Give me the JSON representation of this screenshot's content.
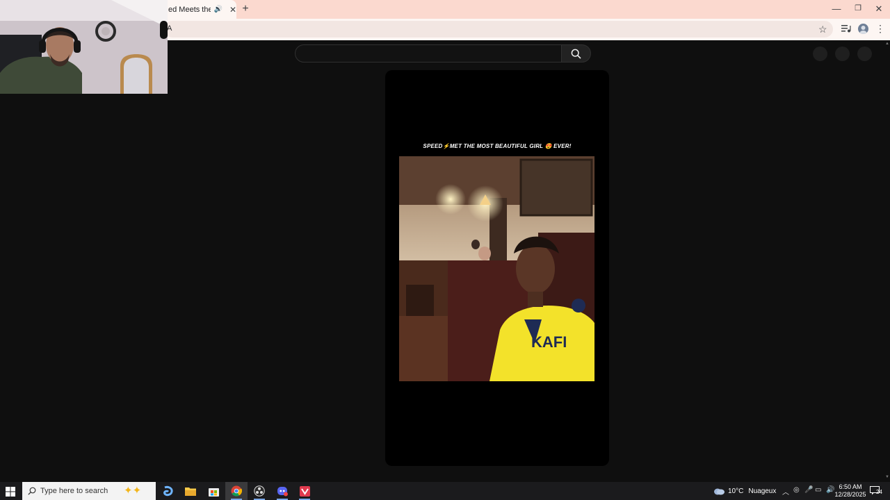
{
  "browser": {
    "tab_title": "ed Meets the Mo",
    "new_tab_label": "+",
    "address_text": "A",
    "window_controls": {
      "minimize": "—",
      "restore": "❐",
      "close": "✕"
    }
  },
  "page": {
    "search_placeholder": "",
    "video_caption": "SPEED⚡MET THE MOST BEAUTIFUL GIRL 😍 EVER!"
  },
  "taskbar": {
    "search_placeholder": "Type here to search",
    "weather_temp": "10°C",
    "weather_text": "Nuageux",
    "time": "6:50 AM",
    "date": "12/28/2025",
    "notification_count": "24"
  },
  "colors": {
    "tabbar": "#fbd9cf",
    "toolbar": "#fdf6f3",
    "page_background": "#0f0f0f",
    "player_background": "#000000",
    "taskbar": "#1b1b1d"
  },
  "icons": [
    "speaker-icon",
    "close-icon",
    "plus-icon",
    "star-icon",
    "media-control-icon",
    "profile-icon",
    "menu-icon",
    "search-icon",
    "windows-start-icon",
    "copilot-icon",
    "file-explorer-icon",
    "store-icon",
    "chrome-icon",
    "obs-icon",
    "discord-icon",
    "app-icon",
    "cloud-icon",
    "chevron-up-icon",
    "microphone-icon",
    "network-icon",
    "volume-icon",
    "notification-icon"
  ]
}
